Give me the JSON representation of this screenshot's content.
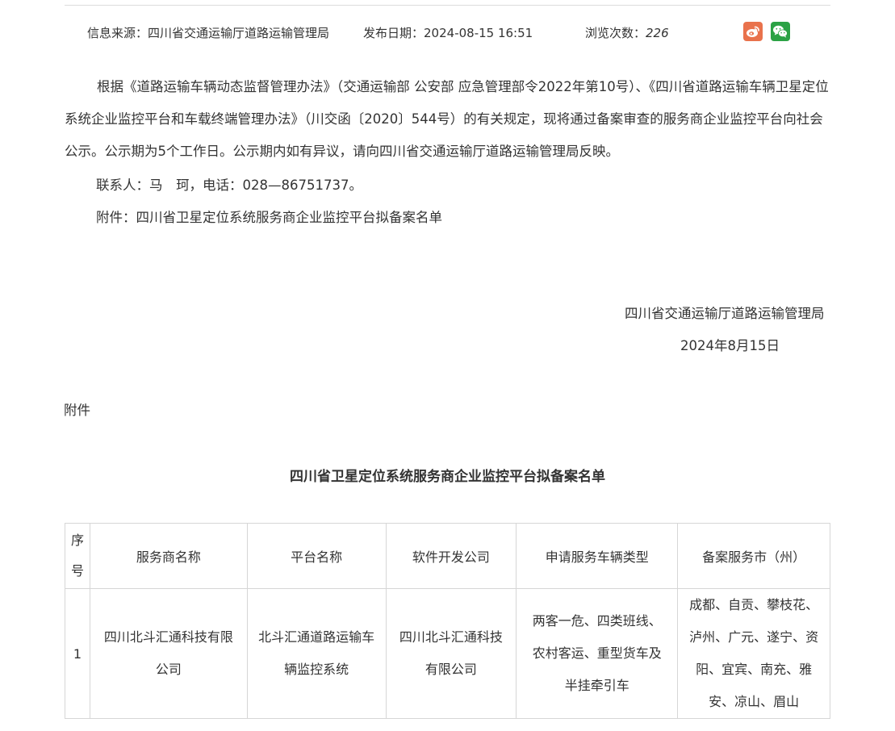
{
  "meta": {
    "source_label": "信息来源：",
    "source_value": "四川省交通运输厅道路运输管理局",
    "date_label": "发布日期：",
    "date_value": "2024-08-15 16:51",
    "views_label": "浏览次数：",
    "views_value": "226"
  },
  "share": {
    "weibo_icon": "weibo-icon",
    "wechat_icon": "wechat-icon"
  },
  "body": {
    "paragraph1": "根据《道路运输车辆动态监督管理办法》（交通运输部 公安部 应急管理部令2022年第10号）、《四川省道路运输车辆卫星定位系统企业监控平台和车载终端管理办法》（川交函〔2020〕544号）的有关规定，现将通过备案审查的服务商企业监控平台向社会公示。公示期为5个工作日。公示期内如有异议，请向四川省交通运输厅道路运输管理局反映。",
    "contact": "联系人：马　珂，电话：028—86751737。",
    "attachment_line": "附件：四川省卫星定位系统服务商企业监控平台拟备案名单"
  },
  "signature": {
    "org": "四川省交通运输厅道路运输管理局",
    "date": "2024年8月15日"
  },
  "attachment": {
    "label": "附件",
    "title": "四川省卫星定位系统服务商企业监控平台拟备案名单",
    "headers": {
      "seq_a": "序",
      "seq_b": "号",
      "provider": "服务商名称",
      "platform": "平台名称",
      "developer": "软件开发公司",
      "vehicle_types": "申请服务车辆类型",
      "cities": "备案服务市（州）"
    },
    "rows": [
      {
        "seq": "1",
        "provider": "四川北斗汇通科技有限公司",
        "platform": "北斗汇通道路运输车辆监控系统",
        "developer": "四川北斗汇通科技有限公司",
        "vehicle_types": "两客一危、四类班线、农村客运、重型货车及半挂牵引车",
        "cities": "成都、自贡、攀枝花、泸州、广元、遂宁、资阳、宜宾、南充、雅安、凉山、眉山"
      }
    ]
  }
}
